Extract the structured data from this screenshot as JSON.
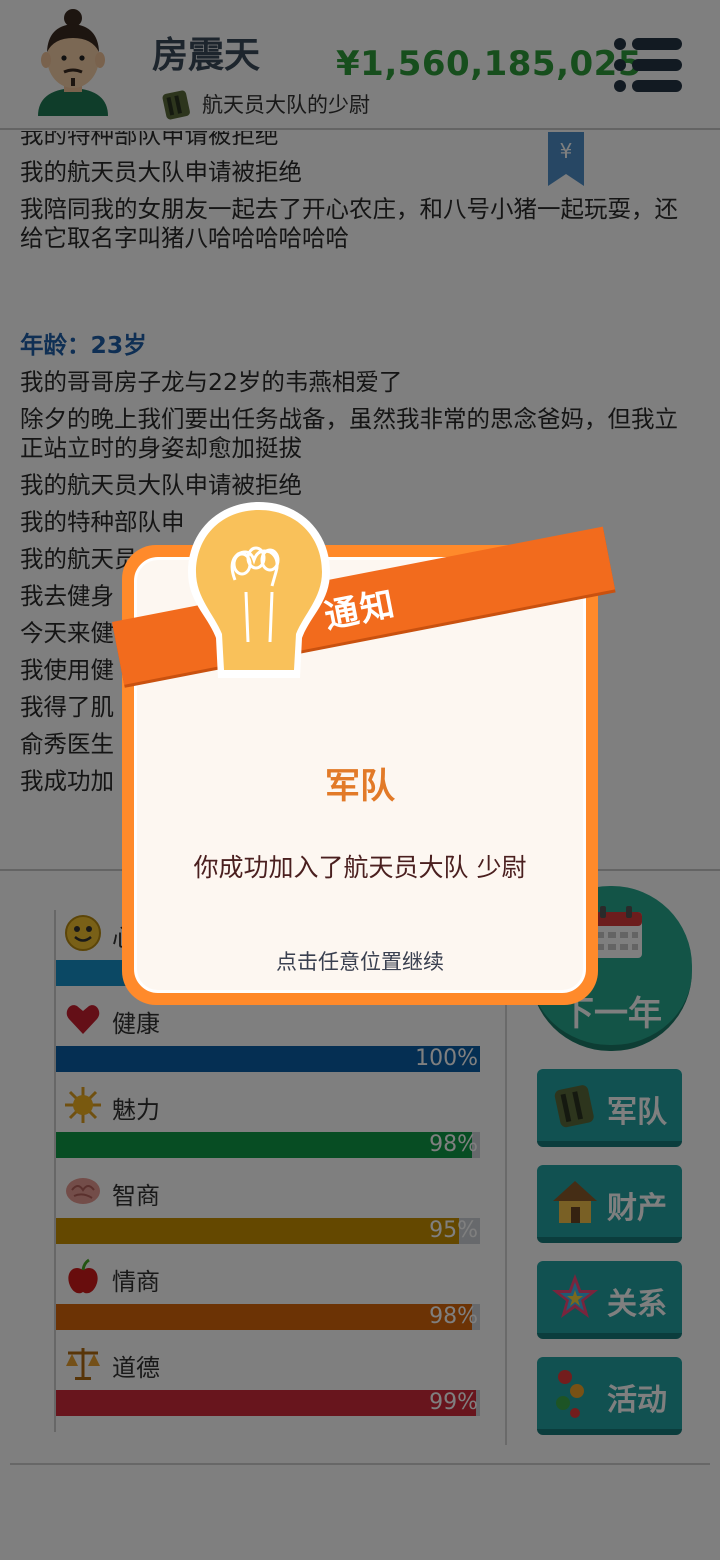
{
  "header": {
    "player_name": "房震天",
    "money": "¥1,560,185,025",
    "rank": "航天员大队的少尉"
  },
  "log": {
    "lines_before": [
      "我的特种部队申请被拒绝",
      "我的航天员大队申请被拒绝",
      "我陪同我的女朋友一起去了开心农庄，和八号小猪一起玩耍，还给它取名字叫猪八哈哈哈哈哈哈"
    ],
    "age_label": "年龄：23岁",
    "lines_after": [
      "我的哥哥房子龙与22岁的韦燕相爱了",
      "除夕的晚上我们要出任务战备，虽然我非常的思念爸妈，但我立正站立时的身姿却愈加挺拔",
      "我的航天员大队申请被拒绝",
      "我的特种部队申",
      "我的航天员",
      "我去健身",
      "今天来健                                    下跑步机（200",
      "我使用健",
      "我得了肌",
      "俞秀医生",
      "我成功加"
    ]
  },
  "stats": [
    {
      "label": "心",
      "value": 100,
      "pct": "",
      "color": "#1691c9",
      "icon": "smiley-icon"
    },
    {
      "label": "健康",
      "value": 100,
      "pct": "100%",
      "color": "#0a5fa6",
      "icon": "heart-icon"
    },
    {
      "label": "魅力",
      "value": 98,
      "pct": "98%",
      "color": "#0e9a46",
      "icon": "sun-icon"
    },
    {
      "label": "智商",
      "value": 95,
      "pct": "95%",
      "color": "#c89000",
      "icon": "brain-icon"
    },
    {
      "label": "情商",
      "value": 98,
      "pct": "98%",
      "color": "#d9660b",
      "icon": "apple-icon"
    },
    {
      "label": "道德",
      "value": 99,
      "pct": "99%",
      "color": "#d12b3b",
      "icon": "scales-icon"
    }
  ],
  "actions": {
    "next_year": "下一年",
    "military": "军队",
    "assets": "财产",
    "relations": "关系",
    "activities": "活动"
  },
  "dialog": {
    "ribbon": "通知",
    "title": "军队",
    "message": "你成功加入了航天员大队 少尉",
    "hint": "点击任意位置继续"
  }
}
